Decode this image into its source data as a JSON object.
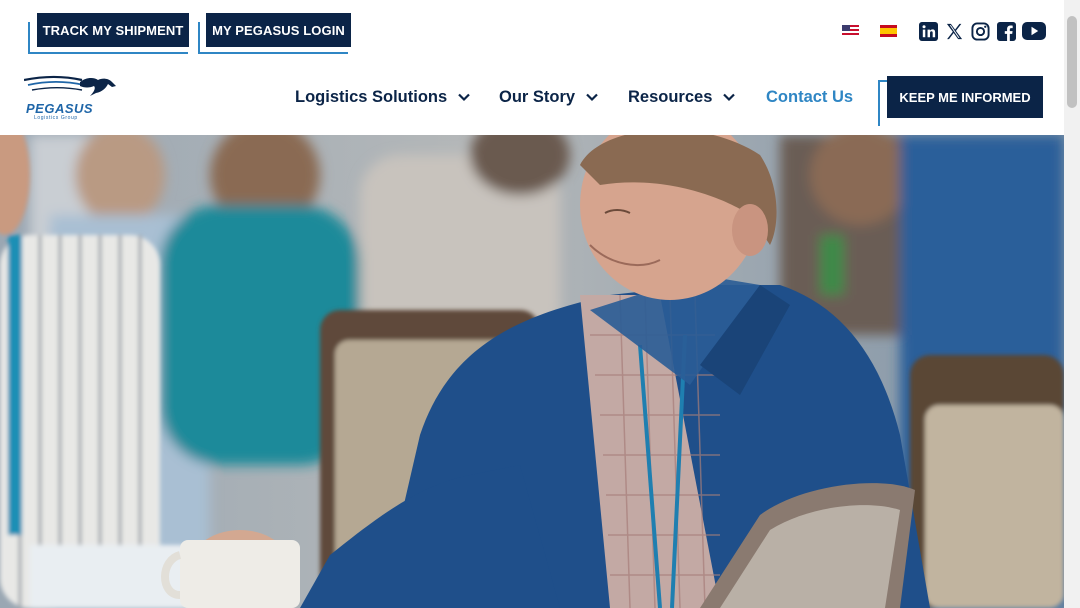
{
  "top_buttons": {
    "track_label": "TRACK MY SHIPMENT",
    "login_label": "MY PEGASUS LOGIN"
  },
  "languages": [
    "us-flag-icon",
    "spain-flag-icon"
  ],
  "social_icons": [
    "linkedin-icon",
    "x-icon",
    "instagram-icon",
    "facebook-icon",
    "youtube-icon"
  ],
  "logo": {
    "name": "PEGASUS",
    "tagline": "Logistics Group"
  },
  "nav": {
    "solutions": "Logistics Solutions",
    "story": "Our Story",
    "resources": "Resources",
    "contact": "Contact Us"
  },
  "cta": {
    "label": "KEEP ME INFORMED"
  },
  "colors": {
    "navy": "#0b2447",
    "accent_blue": "#2f86c4",
    "white": "#ffffff"
  },
  "hero": {
    "icon": "conference-photo"
  }
}
